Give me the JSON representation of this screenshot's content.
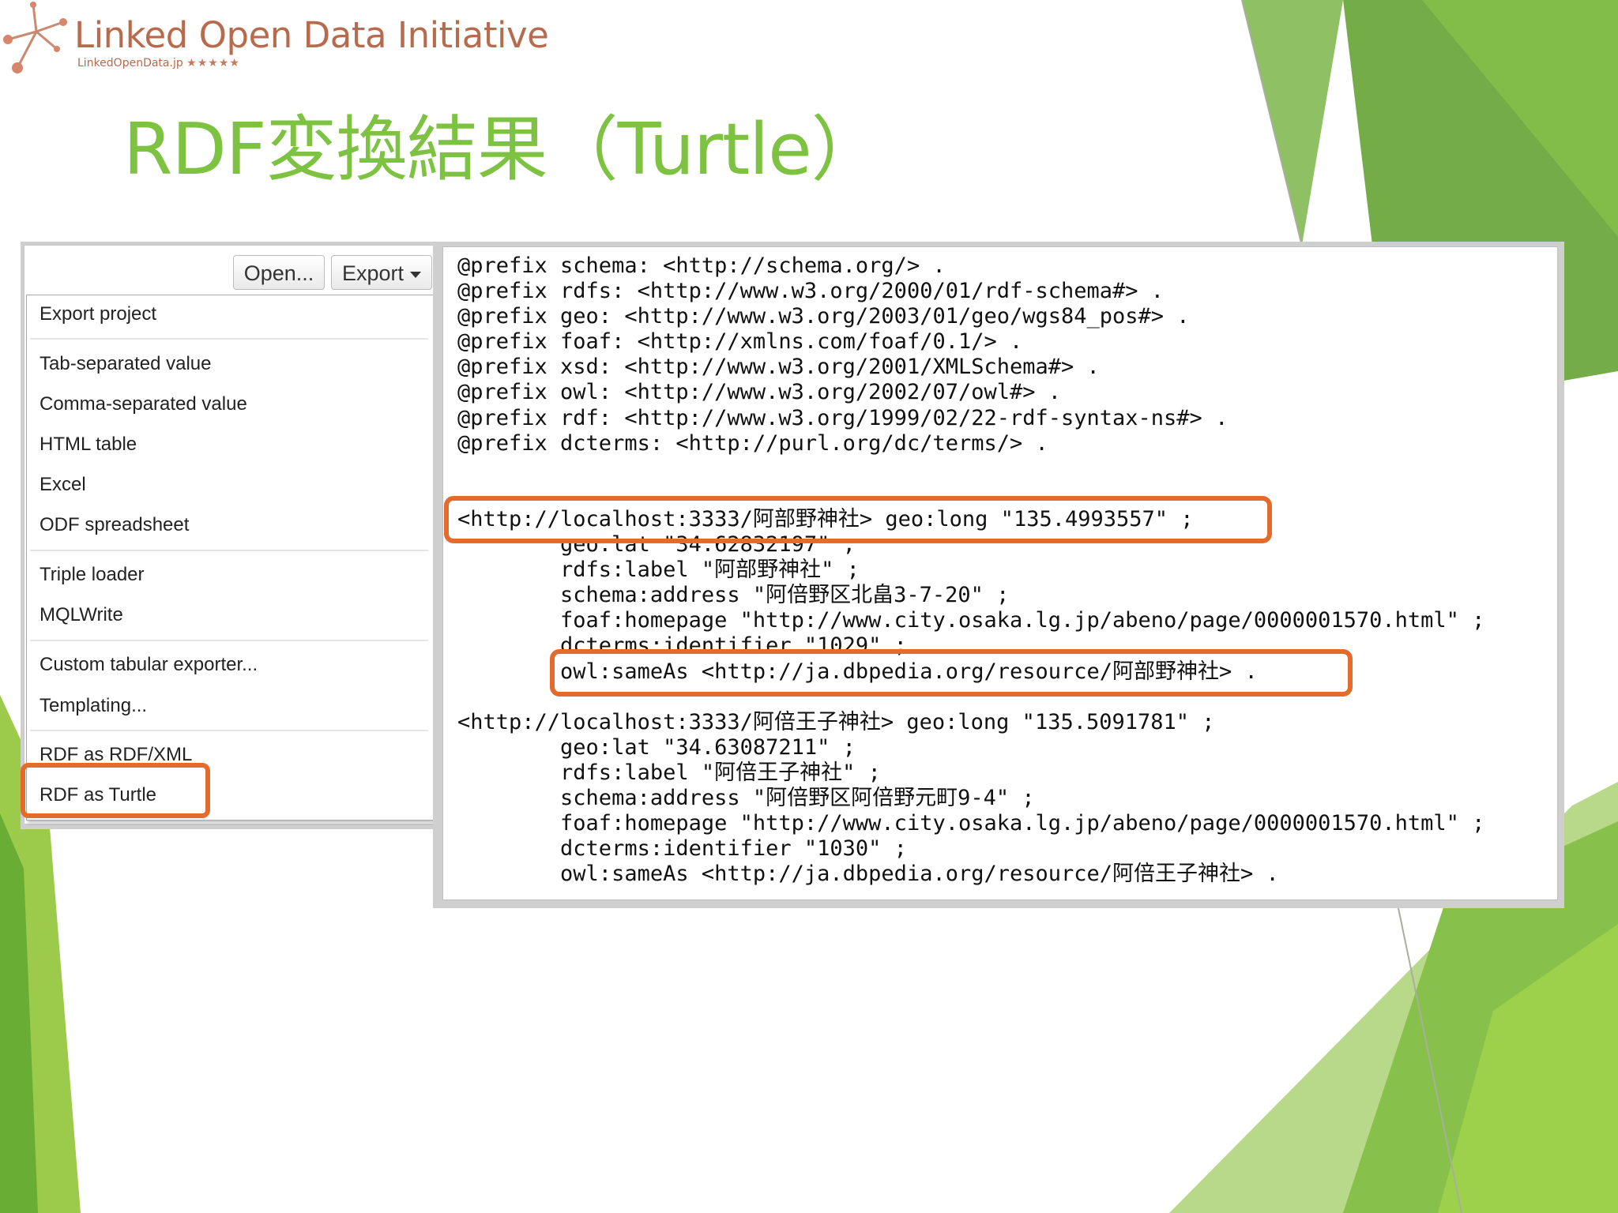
{
  "logo": {
    "title": "Linked Open Data Initiative",
    "subtitle": "LinkedOpenData.jp",
    "stars": "★★★★★"
  },
  "slide": {
    "title": "RDF変換結果（Turtle）"
  },
  "toolbar": {
    "open_label": "Open...",
    "export_label": "Export"
  },
  "export_menu": {
    "items": [
      "Export project",
      "Tab-separated value",
      "Comma-separated value",
      "HTML table",
      "Excel",
      "ODF spreadsheet",
      "Triple loader",
      "MQLWrite",
      "Custom tabular exporter...",
      "Templating...",
      "RDF as RDF/XML",
      "RDF as Turtle"
    ],
    "highlighted": "RDF as Turtle"
  },
  "turtle": {
    "prefixes": [
      "@prefix schema: <http://schema.org/> .",
      "@prefix rdfs: <http://www.w3.org/2000/01/rdf-schema#> .",
      "@prefix geo: <http://www.w3.org/2003/01/geo/wgs84_pos#> .",
      "@prefix foaf: <http://xmlns.com/foaf/0.1/> .",
      "@prefix xsd: <http://www.w3.org/2001/XMLSchema#> .",
      "@prefix owl: <http://www.w3.org/2002/07/owl#> .",
      "@prefix rdf: <http://www.w3.org/1999/02/22-rdf-syntax-ns#> .",
      "@prefix dcterms: <http://purl.org/dc/terms/> ."
    ],
    "record1": [
      "<http://localhost:3333/阿部野神社> geo:long \"135.4993557\" ;",
      "        geo:lat \"34.62832197\" ;",
      "        rdfs:label \"阿部野神社\" ;",
      "        schema:address \"阿倍野区北畠3-7-20\" ;",
      "        foaf:homepage \"http://www.city.osaka.lg.jp/abeno/page/0000001570.html\" ;",
      "        dcterms:identifier \"1029\" ;",
      "        owl:sameAs <http://ja.dbpedia.org/resource/阿部野神社> ."
    ],
    "record2": [
      "<http://localhost:3333/阿倍王子神社> geo:long \"135.5091781\" ;",
      "        geo:lat \"34.63087211\" ;",
      "        rdfs:label \"阿倍王子神社\" ;",
      "        schema:address \"阿倍野区阿倍野元町9-4\" ;",
      "        foaf:homepage \"http://www.city.osaka.lg.jp/abeno/page/0000001570.html\" ;",
      "        dcterms:identifier \"1030\" ;",
      "        owl:sameAs <http://ja.dbpedia.org/resource/阿倍王子神社> ."
    ]
  },
  "colors": {
    "title_green": "#7dc241",
    "highlight_orange": "#e36c2c",
    "logo_brown": "#b86a4d"
  }
}
